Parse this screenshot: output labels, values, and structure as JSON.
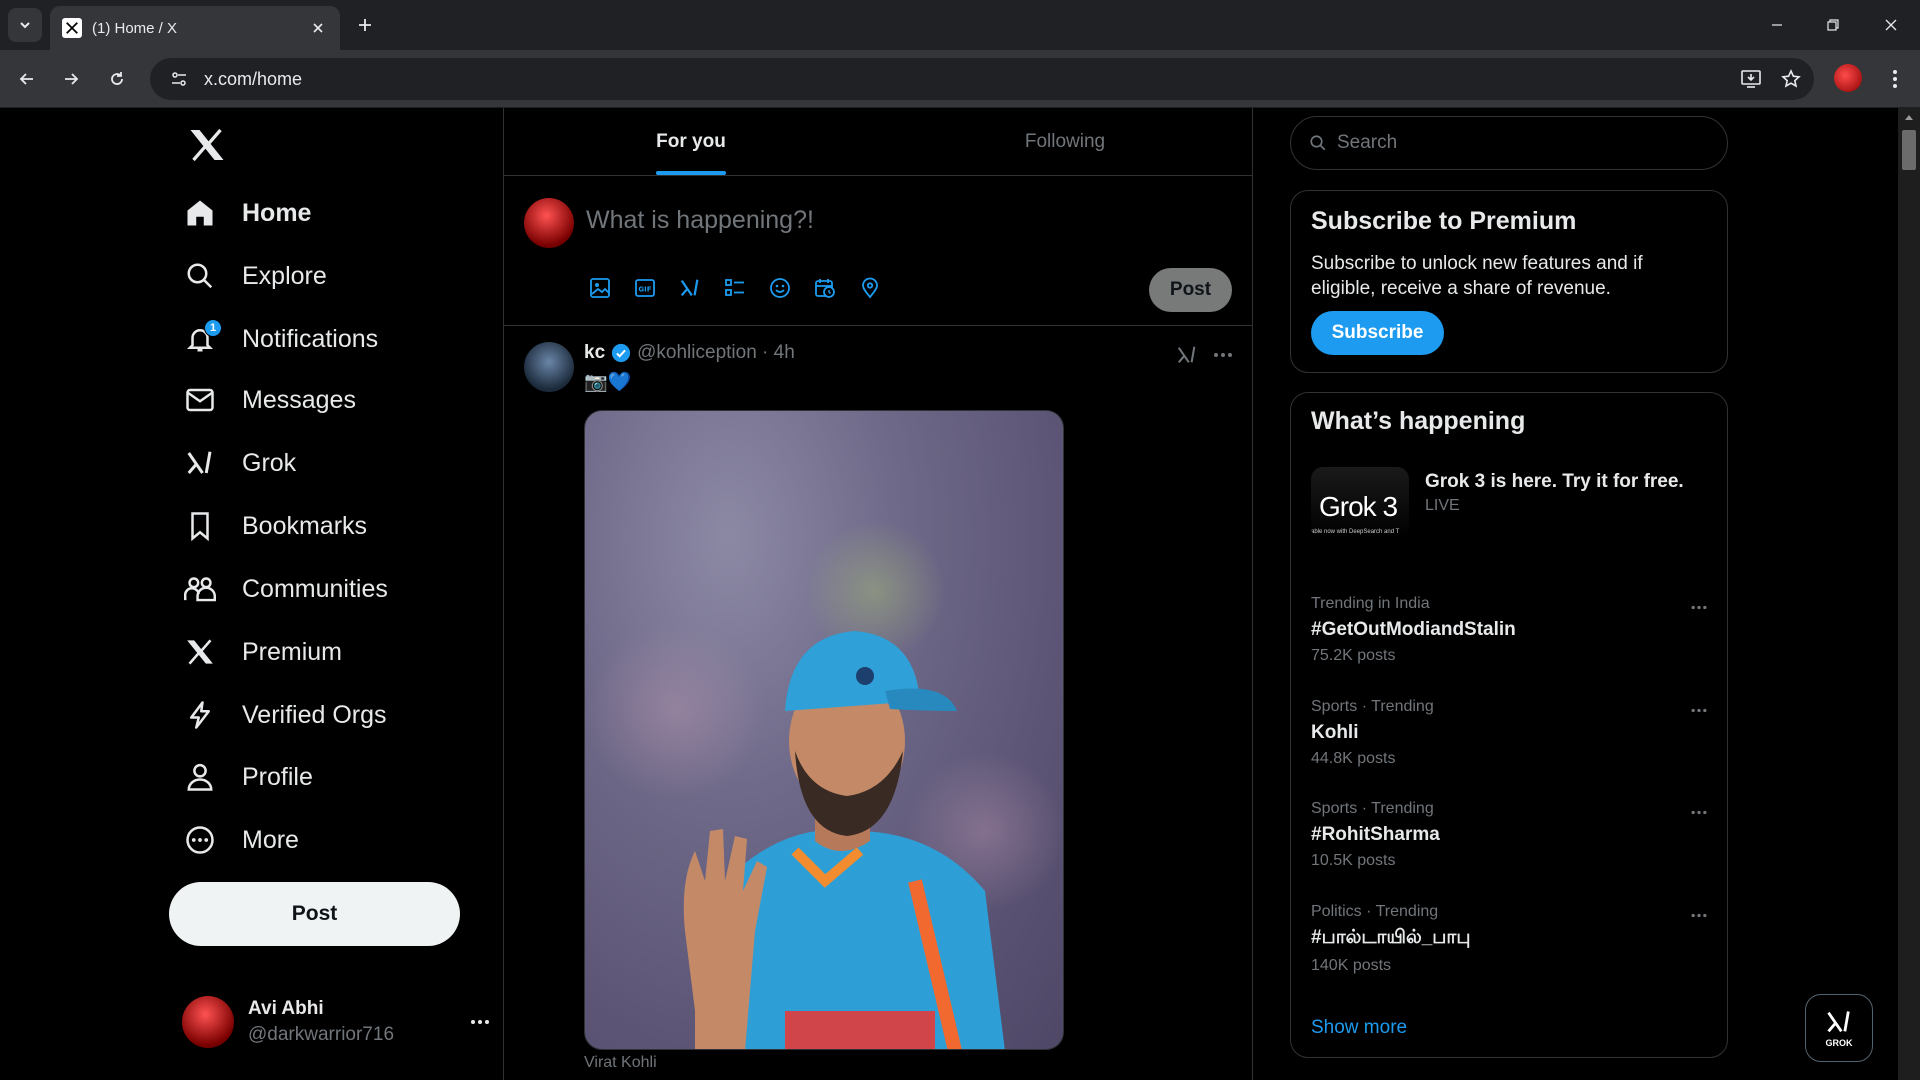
{
  "browser": {
    "tab_title": "(1) Home / X",
    "url": "x.com/home"
  },
  "leftnav": {
    "items": [
      {
        "label": "Home",
        "icon": "home-icon",
        "active": true
      },
      {
        "label": "Explore",
        "icon": "search-icon"
      },
      {
        "label": "Notifications",
        "icon": "bell-icon",
        "badge": "1"
      },
      {
        "label": "Messages",
        "icon": "mail-icon"
      },
      {
        "label": "Grok",
        "icon": "grok-icon"
      },
      {
        "label": "Bookmarks",
        "icon": "bookmark-icon"
      },
      {
        "label": "Communities",
        "icon": "people-icon"
      },
      {
        "label": "Premium",
        "icon": "x-logo-icon"
      },
      {
        "label": "Verified Orgs",
        "icon": "lightning-icon"
      },
      {
        "label": "Profile",
        "icon": "person-icon"
      },
      {
        "label": "More",
        "icon": "more-circle-icon"
      }
    ],
    "post_label": "Post",
    "account": {
      "name": "Avi Abhi",
      "handle": "@darkwarrior716"
    }
  },
  "feed": {
    "tabs": [
      {
        "label": "For you",
        "active": true
      },
      {
        "label": "Following",
        "active": false
      }
    ],
    "composer": {
      "placeholder": "What is happening?!",
      "post_label": "Post"
    },
    "tweet": {
      "name": "kc",
      "handle": "@kohliception",
      "time": "4h",
      "text": "📷💙",
      "caption": "Virat Kohli"
    }
  },
  "right": {
    "search_placeholder": "Search",
    "premium": {
      "title": "Subscribe to Premium",
      "description": "Subscribe to unlock new features and if eligible, receive a share of revenue.",
      "button": "Subscribe"
    },
    "happening": {
      "title": "What’s happening",
      "grok": {
        "thumb_text": "Grok 3",
        "thumb_sub": "able now with DeepSearch and T",
        "title": "Grok 3 is here. Try it for free.",
        "status": "LIVE"
      },
      "trends": [
        {
          "category": "Trending in India",
          "name": "#GetOutModiandStalin",
          "count": "75.2K posts"
        },
        {
          "category": "Sports · Trending",
          "name": "Kohli",
          "count": "44.8K posts"
        },
        {
          "category": "Sports · Trending",
          "name": "#RohitSharma",
          "count": "10.5K posts"
        },
        {
          "category": "Politics · Trending",
          "name": "#பால்டாயில்_பாபு",
          "count": "140K posts"
        }
      ],
      "show_more": "Show more"
    },
    "grok_fab_label": "GROK"
  },
  "colors": {
    "accent": "#1d9bf0",
    "background": "#000000",
    "border": "#2f3336",
    "muted": "#71767b"
  }
}
